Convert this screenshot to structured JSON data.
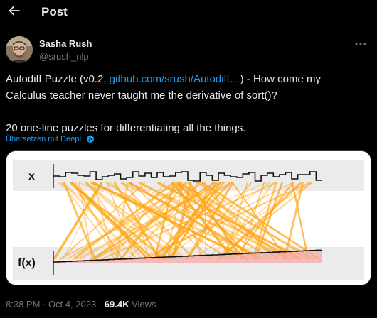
{
  "header": {
    "back_icon": "arrow-left-icon",
    "title": "Post"
  },
  "author": {
    "name": "Sasha Rush",
    "handle": "@srush_nlp",
    "avatar_icon": "avatar-photo"
  },
  "more_icon": "more-horizontal-icon",
  "tweet": {
    "line1_before": "Autodiff Puzzle (v0.2, ",
    "link_text": "github.com/srush/Autodiff…",
    "line1_after": ") - How come my",
    "line2": "Calculus teacher never taught me the derivative of sort()?",
    "line3": "20 one-line puzzles for differentiating all the things."
  },
  "translate": {
    "label": "Übersetzen mit DeepL",
    "icon": "deepl-icon"
  },
  "media": {
    "x_label": "x",
    "fx_label": "f(x)",
    "colors": {
      "band": "#ebebeb",
      "lines": "#ffa514",
      "step": "#111111"
    }
  },
  "footer": {
    "time": "8:38 PM",
    "separator": " · ",
    "date": "Oct 4, 2023",
    "views_count": "69.4K",
    "views_label": " Views"
  }
}
